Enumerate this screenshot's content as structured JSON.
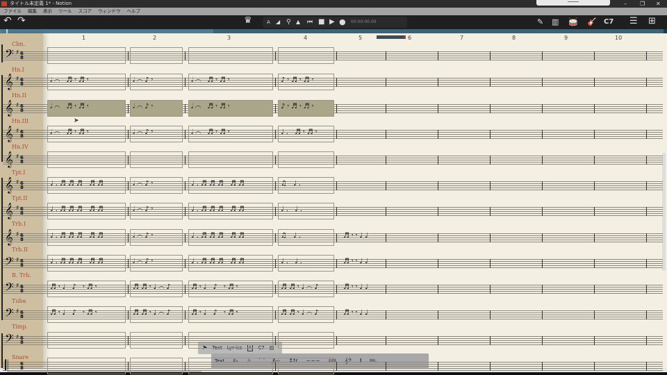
{
  "window": {
    "title": "タイトル未定義 1* - Notion",
    "minimize": "–",
    "maximize": "❐",
    "close": "✕"
  },
  "menu": [
    "ファイル",
    "編集",
    "表示",
    "ツール",
    "スコア",
    "ウィンドウ",
    "ヘルプ"
  ],
  "toolbar": {
    "undo": "↶",
    "redo": "↷",
    "conductor": "♛",
    "time": "00:00:00.00",
    "chord_label": "C7",
    "transport": [
      "A",
      "◢",
      "⚲",
      "▲",
      "⏮",
      "■",
      "▶",
      "●"
    ],
    "right_icons": [
      "✎",
      "▥",
      "🥁",
      "🎸"
    ],
    "list": "☰",
    "mixer": "⊞"
  },
  "measure_numbers": [
    "1",
    "2",
    "3",
    "4",
    "5",
    "6",
    "7",
    "8",
    "9",
    "10"
  ],
  "time_signature": {
    "top": "6",
    "bottom": "8"
  },
  "key_signature": "♯",
  "staves": [
    {
      "name": "Cbn.",
      "clef": "bass",
      "selected": false,
      "measures": [
        "",
        "",
        "",
        ""
      ]
    },
    {
      "name": "Hn.I",
      "clef": "treble",
      "selected": false,
      "measures": [
        "𝅗𝅥⌒ ♬𝄾♬𝄾",
        "𝅗𝅥⌒♪𝄾",
        "𝅗𝅥⌒ ♬𝄾♬𝄾",
        "♪𝄾♬𝄾♬𝄾"
      ]
    },
    {
      "name": "Hn.II",
      "clef": "treble",
      "selected": true,
      "measures": [
        "𝅗𝅥⌒ ♬𝄾♬𝄾",
        "𝅗𝅥⌒♪𝄾",
        "𝅗𝅥⌒ ♬𝄾♬𝄾",
        "♪𝄾♬𝄾♬𝄾"
      ]
    },
    {
      "name": "Hn.III",
      "clef": "treble",
      "selected": false,
      "measures": [
        "𝅗𝅥⌒ ♬𝄾♬𝄾",
        "𝅗𝅥⌒♪𝄾",
        "𝅗𝅥⌒ ♬𝄾♬𝄾",
        "♩. ♬𝄾♬𝄾"
      ]
    },
    {
      "name": "Hn.IV",
      "clef": "treble",
      "selected": false,
      "measures": [
        "",
        "",
        "",
        ""
      ]
    },
    {
      "name": "Tpt.I",
      "clef": "treble",
      "selected": false,
      "measures": [
        "♩.♬♬♬ ♬♬",
        "𝅗𝅥⌒♪𝄾",
        "♩.♬♬♬ ♬♬",
        "♫ ♩."
      ]
    },
    {
      "name": "Tpt.II",
      "clef": "treble",
      "selected": false,
      "measures": [
        "♩.♬♬♬ ♬♬",
        "𝅗𝅥⌒♪𝄾",
        "♩.♬♬♬ ♬♬",
        "♩. ♩."
      ]
    },
    {
      "name": "Trb.I",
      "clef": "treble",
      "selected": false,
      "measures": [
        "♩.♬♬♬ ♬♬",
        "𝅗𝅥⌒♪𝄾",
        "♩.♬♬♬ ♬♬",
        "♫ ♩.",
        "♬𝄾𝄾♩♩"
      ]
    },
    {
      "name": "Trb.II",
      "clef": "bass",
      "selected": false,
      "measures": [
        "♩.♬♬♬ ♬♬",
        "𝅗𝅥⌒♪𝄾",
        "♩.♬♬♬ ♬♬",
        "♩. ♩.",
        "♬𝄾𝄾♩♩"
      ]
    },
    {
      "name": "B. Trb.",
      "clef": "bass",
      "selected": false,
      "measures": [
        "♬𝄾♩   ♪ 𝄾♬𝄾",
        "♬♬𝄾♩⌒♪",
        "♬𝄾♩  ♪ 𝄾♬𝄾",
        "♬♬𝄾♩⌒♪",
        "♬𝄾𝄾♩♩"
      ]
    },
    {
      "name": "Tuba",
      "clef": "bass",
      "selected": false,
      "measures": [
        "♬𝄾♩   ♪ 𝄾♬𝄾",
        "♬♬𝄾♩⌒♪",
        "♬𝄾♩  ♪ 𝄾♬𝄾",
        "♬♬𝄾♩⌒♪",
        "♬𝄾𝄾♩♩"
      ]
    },
    {
      "name": "Timp.",
      "clef": "bass",
      "selected": false,
      "measures": [
        "",
        "",
        "",
        ""
      ]
    },
    {
      "name": "Snare",
      "clef": "perc",
      "selected": false,
      "measures": [
        "",
        "",
        "",
        ""
      ]
    }
  ],
  "palette": {
    "row1": [
      "Text",
      "Lyr-ics",
      "A",
      "C7",
      "▤"
    ],
    "row2": [
      "Text",
      "♯♭",
      "♩𝄾",
      "⌒",
      "𝆑—",
      "↕tr",
      "~~~",
      "♯♯♯",
      "𝄞𝄢",
      "𝄂",
      "Hn."
    ]
  },
  "colors": {
    "label": "#b24a36",
    "panel": "#cdbf9f",
    "paper": "#f3efe3",
    "selection": "#a9a68a",
    "timeline": "#3b6478"
  }
}
